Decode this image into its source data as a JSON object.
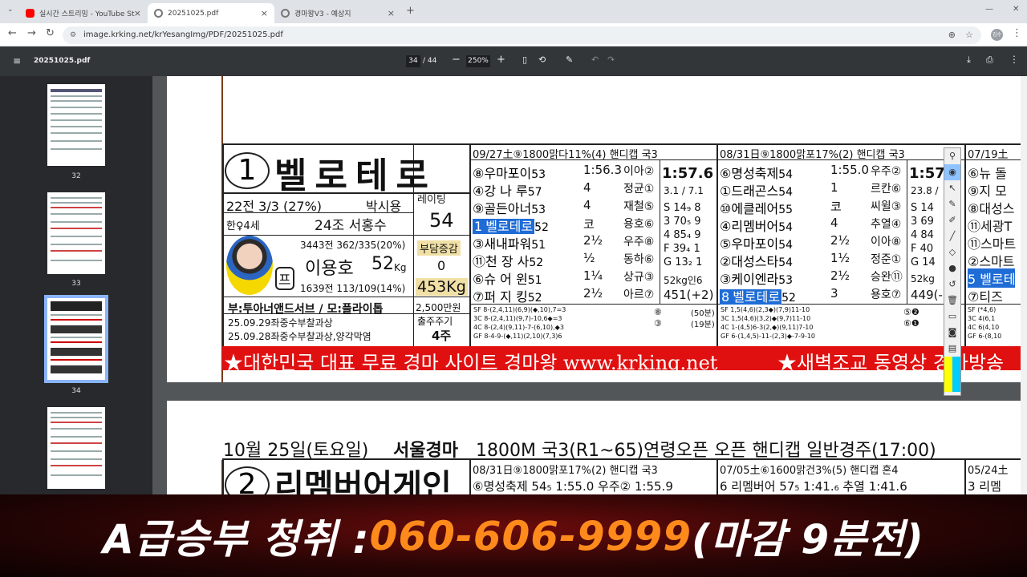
{
  "browser": {
    "tabs": [
      {
        "label": "실시간 스트리밍 - YouTube St",
        "color": "#ff0000"
      },
      {
        "label": "20251025.pdf",
        "color": "#777777"
      },
      {
        "label": "경마왕V3 - 예상지",
        "color": "#777777"
      }
    ],
    "new_tab": "+",
    "url": "image.krking.net/krYesangImg/PDF/20251025.pdf",
    "profile": "김수"
  },
  "pdf_toolbar": {
    "filename": "20251025.pdf",
    "page_current": "34",
    "page_total": "/ 44",
    "zoom": "250%"
  },
  "thumbnails": [
    {
      "num": "32"
    },
    {
      "num": "33"
    },
    {
      "num": "34",
      "selected": true
    },
    {
      "num": ""
    }
  ],
  "entry1": {
    "number": "1",
    "name": "벨로테로",
    "record": "22전 3/3 (27%)",
    "owner": "박시용",
    "rating_label": "레이팅",
    "rating": "54",
    "sex_age": "한♀4세",
    "trainer": "24조 서홍수",
    "trainer_stats": "3443전 362/335(20%)",
    "jockey": "이용호",
    "weight": "52",
    "weight_unit": "Kg",
    "burden_label": "부담증감",
    "burden": "0",
    "jockey_stats": "1639전 113/109(14%)",
    "horse_weight": "453Kg",
    "pedigree": "부:투아너앤드서브 / 모:플라이톱",
    "prize": "2,500만원",
    "note1": "25.09.29좌중수부찰과상",
    "note2": "25.09.28좌중수부찰과상,양각막염",
    "starts_label": "출주주기",
    "starts": "4주",
    "pro_badge": "프"
  },
  "race_a": {
    "header": "09/27土⑨1800맑다11%(4) 핸디캡 국3",
    "rows": [
      {
        "pos": "⑧",
        "name": "우마포이",
        "wt": "53",
        "v": "1:56.3",
        "j": "이아②"
      },
      {
        "pos": "④",
        "name": "강 나 루",
        "wt": "57",
        "v": "4",
        "j": "정균①"
      },
      {
        "pos": "⑨",
        "name": "골든아너",
        "wt": "53",
        "v": "4",
        "j": "재철⑤"
      },
      {
        "pos": "1",
        "name": "벨로테로",
        "wt": "52",
        "v": "코",
        "j": "용호⑥",
        "hl": true
      },
      {
        "pos": "③",
        "name": "새내파워",
        "wt": "51",
        "v": "2½",
        "j": "우주⑧"
      },
      {
        "pos": "⑪",
        "name": "천 장 사",
        "wt": "52",
        "v": "½",
        "j": "동하⑥"
      },
      {
        "pos": "⑥",
        "name": "슈 어 윈",
        "wt": "51",
        "v": "1¼",
        "j": "상규③"
      },
      {
        "pos": "⑦",
        "name": "퍼 지 킹",
        "wt": "52",
        "v": "2½",
        "j": "아르⑦"
      }
    ],
    "time": "1:57.6",
    "odds": "3.1 / 7.1",
    "s": "S 14₉ 8",
    "three": "3 70₅ 9",
    "four": "4 85₄ 9",
    "f": "F 39₄ 1",
    "g": "G 13₂ 1",
    "wt": "52kg인6",
    "hw": "451(+2)",
    "sf": [
      "SF 8-(2,4,11)(6,9)(◆,10),7=3",
      "3C 8-(2,4,11)(9,7)-10,6◆=3",
      "4C 8-(2,4)(9,11)-7-(6,10),◆3",
      "GF 8-4-9-(◆,11)(2,10)(7,3)6"
    ],
    "side": [
      "⑧",
      "③"
    ],
    "side2": [
      "(50분)",
      "(19분)"
    ]
  },
  "race_b": {
    "header": "08/31日⑨1800맑포17%(2) 핸디캡 국3",
    "rows": [
      {
        "pos": "⑥",
        "name": "명성축제",
        "wt": "54",
        "v": "1:55.0",
        "j": "우주②"
      },
      {
        "pos": "①",
        "name": "드래곤스",
        "wt": "54",
        "v": "1",
        "j": "르칸⑥"
      },
      {
        "pos": "⑩",
        "name": "에클레어",
        "wt": "55",
        "v": "코",
        "j": "씨윌③"
      },
      {
        "pos": "④",
        "name": "리멤버어",
        "wt": "54",
        "v": "4",
        "j": "추열④"
      },
      {
        "pos": "⑤",
        "name": "우마포이",
        "wt": "54",
        "v": "2½",
        "j": "이아⑧"
      },
      {
        "pos": "②",
        "name": "대성스타",
        "wt": "54",
        "v": "1½",
        "j": "정준①"
      },
      {
        "pos": "③",
        "name": "케이엔라",
        "wt": "53",
        "v": "2½",
        "j": "승완⑪"
      },
      {
        "pos": "8",
        "name": "벨로테로",
        "wt": "52",
        "v": "3",
        "j": "용호⑦",
        "hl": true
      }
    ],
    "time": "1:57",
    "odds": "23.8 /",
    "s": "S 14",
    "three": "3 69",
    "four": "4 84",
    "f": "F 40",
    "g": "G 14",
    "wt": "52kg",
    "hw": "449(-",
    "sf": [
      "SF 1,5(4,6)(2,3◆)(7,9)11-10",
      "3C 1,5(4,6)(3,2)◆(9,7)11-10",
      "4C 1-(4,5)6-3(2,◆)(9,11)7-10",
      "GF 6-(1,4,5)-11-(2,3)◆-7-9-10"
    ],
    "side": [
      "⑤❷",
      "⑥❶"
    ]
  },
  "race_c": {
    "header": "07/19土",
    "rows": [
      "⑥뉴 돌",
      "⑨지 모",
      "⑧대성스",
      "⑪세광T",
      "⑪스마트",
      "②스마트",
      "5 벨로테",
      "⑦티즈"
    ],
    "sf": [
      "SF (*4,6)",
      "3C 4(6,1",
      "4C 6(4,10",
      "GF 6-(8,10"
    ]
  },
  "red_banner": {
    "left": "★대한민국 대표 무료 경마 사이트 경마왕 www.krking.net",
    "right": "★새벽조교 동영상 경마방송"
  },
  "race_info": {
    "date": "10월 25일(토요일)",
    "venue": "서울경마",
    "desc": "1800M 국3(R1~65)연령오픈 오픈 핸디캡 일반경주(17:00)"
  },
  "entry2": {
    "number": "2",
    "name": "리멤버어게인",
    "race_a_header": "08/31日⑨1800맑포17%(2) 핸디캡 국3",
    "race_a_row": "⑥명성축제 54₅ 1:55.0 우주② 1:55.9",
    "race_b_header": "07/05土⑥1600맑건3%(5) 핸디캡 혼4",
    "race_b_row": "6 리멤버어 57₅ 1:41.₆ 추열 1:41.6",
    "race_c_header": "05/24土",
    "race_c_row": "3 리멤"
  },
  "promo": {
    "part1": "A급승부 청취 : ",
    "part2": "060-606-9999",
    "part3": " (마감 9분전)",
    "color_white": "#ffffff",
    "color_orange": "#ff8a1c"
  }
}
